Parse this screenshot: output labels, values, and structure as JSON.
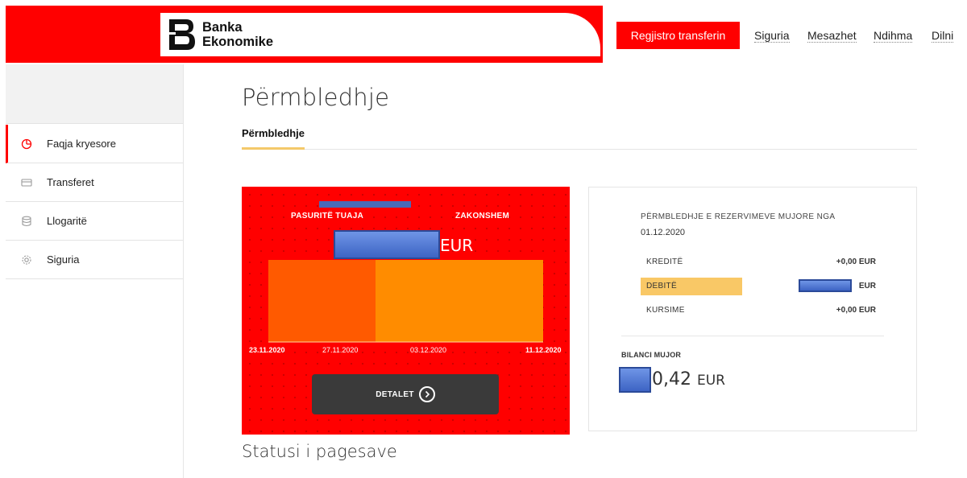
{
  "brand": {
    "line1": "Banka",
    "line2": "Ekonomike",
    "color": "#ff0000"
  },
  "header": {
    "register_label": "Regjistro transferin",
    "nav": [
      "Siguria",
      "Mesazhet",
      "Ndihma",
      "Dilni"
    ]
  },
  "sidebar": {
    "items": [
      {
        "label": "Faqja kryesore",
        "icon": "pie-chart-icon",
        "active": true
      },
      {
        "label": "Transferet",
        "icon": "card-icon",
        "active": false
      },
      {
        "label": "Llogaritë",
        "icon": "database-icon",
        "active": false
      },
      {
        "label": "Siguria",
        "icon": "gear-icon",
        "active": false
      }
    ]
  },
  "main": {
    "title": "Përmbledhje",
    "tab": "Përmbledhje",
    "status_title": "Statusi i pagesave"
  },
  "assets_card": {
    "label_left": "PASURITË TUAJA",
    "label_right": "ZAKONSHEM",
    "currency": "EUR",
    "dates": [
      "23.11.2020",
      "27.11.2020",
      "03.12.2020",
      "11.12.2020"
    ],
    "details_label": "DETALET",
    "colors": {
      "segment_dark": "#ff5a00",
      "segment_light": "#ff8c00"
    }
  },
  "summary_card": {
    "title": "PËRMBLEDHJE E REZERVIMEVE MUJORE NGA",
    "date": "01.12.2020",
    "rows": [
      {
        "label": "KREDITË",
        "value": "+0,00 EUR"
      },
      {
        "label": "DEBITË",
        "value": "EUR"
      },
      {
        "label": "KURSIME",
        "value": "+0,00 EUR"
      }
    ],
    "balance_label": "BILANCI MUJOR",
    "balance_value": "0,42",
    "balance_currency": "EUR",
    "highlight_color": "#f9c866"
  }
}
